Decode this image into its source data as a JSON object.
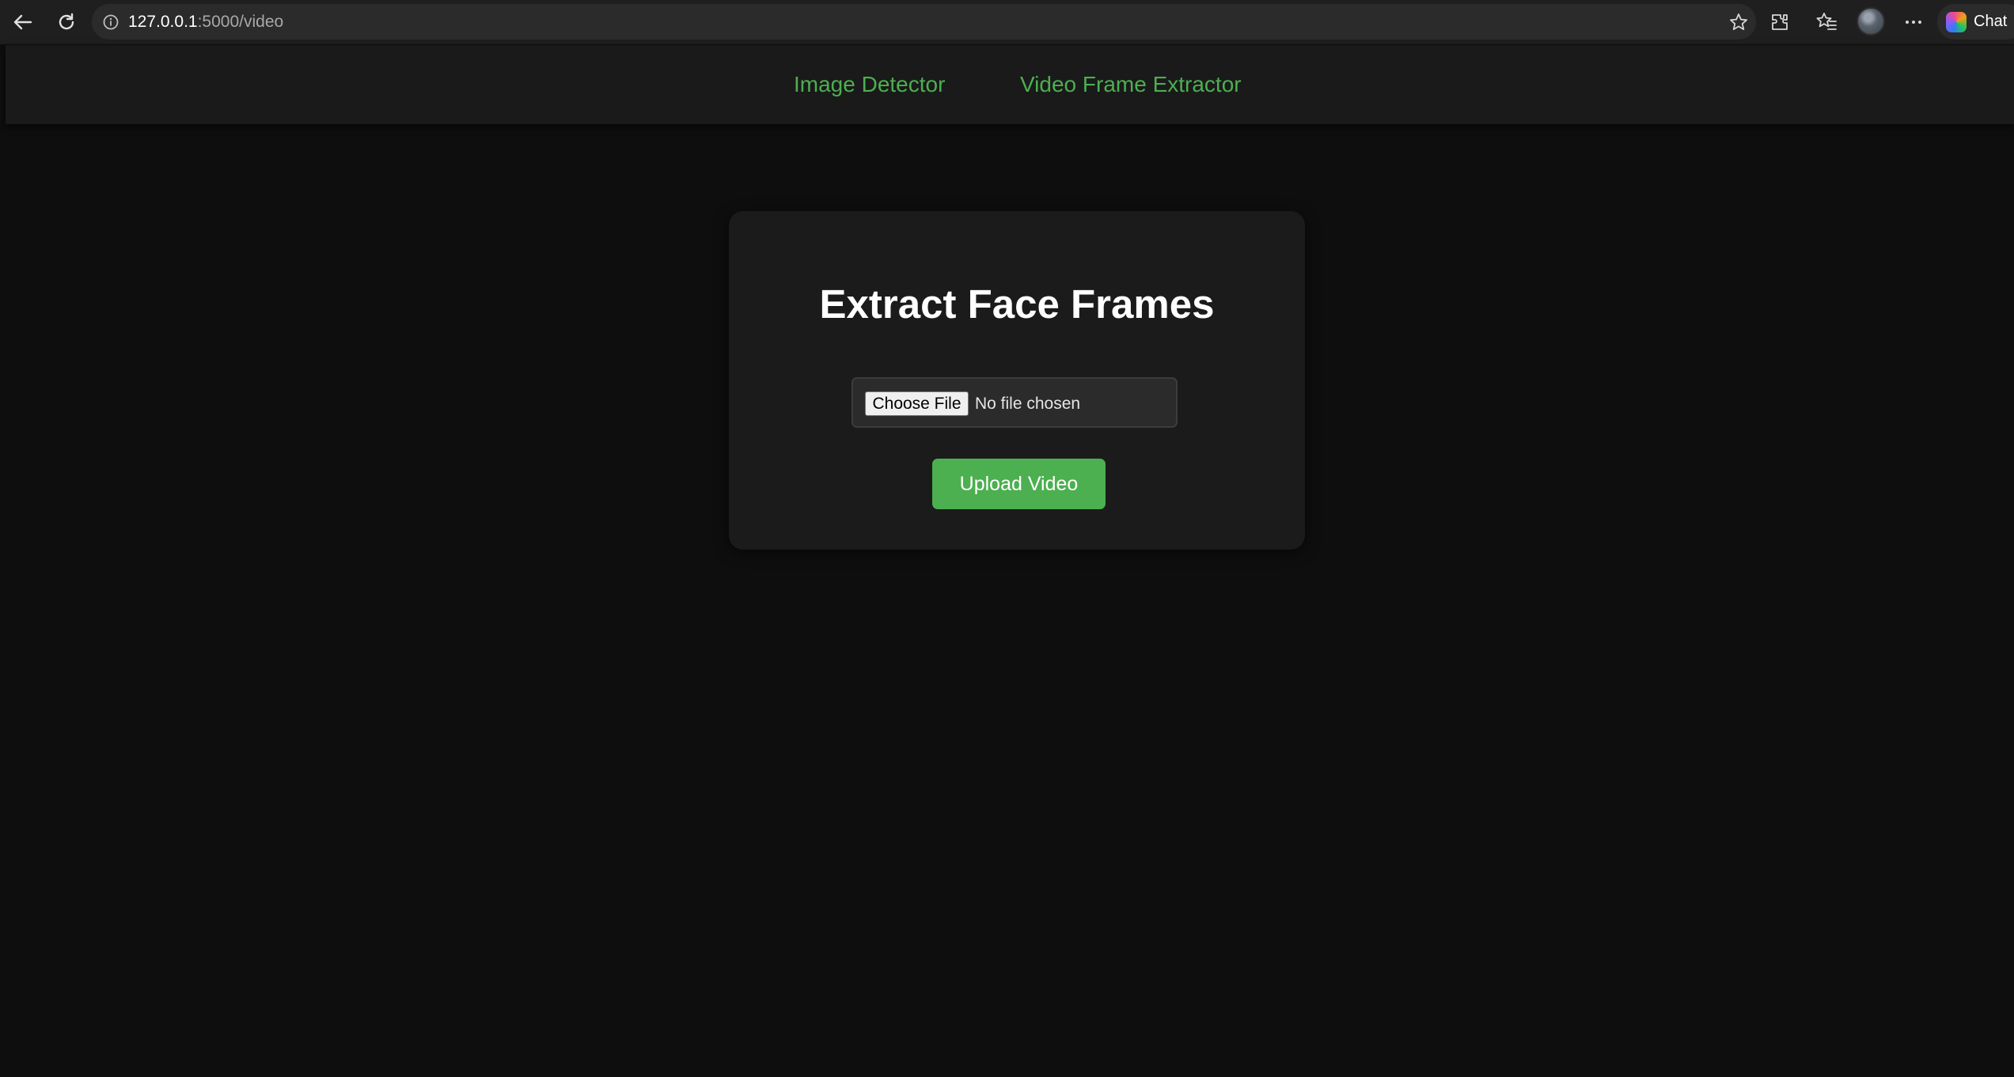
{
  "browser": {
    "url_host": "127.0.0.1",
    "url_rest": ":5000/video",
    "copilot_label": "Chat"
  },
  "site_nav": {
    "links": [
      {
        "label": "Image Detector"
      },
      {
        "label": "Video Frame Extractor"
      }
    ]
  },
  "card": {
    "title": "Extract Face Frames",
    "file_input": {
      "button_label": "Choose File",
      "status": "No file chosen"
    },
    "upload_label": "Upload Video"
  },
  "colors": {
    "accent": "#4caf50",
    "page_bg": "#0e0e0e",
    "card_bg": "#1b1b1b",
    "nav_bg": "#1a1a1a"
  },
  "icons": [
    "back-arrow-icon",
    "refresh-icon",
    "info-icon",
    "star-icon",
    "extensions-icon",
    "favorites-icon",
    "more-icon",
    "copilot-icon"
  ]
}
